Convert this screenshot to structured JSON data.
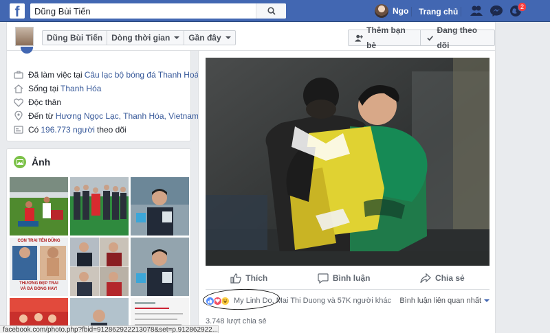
{
  "topbar": {
    "logo": "f",
    "search_value": "Dũng Bùi Tiến",
    "user_name": "Ngo",
    "home_label": "Trang chủ",
    "notification_count": "2",
    "brand_color": "#4267b2"
  },
  "profile_strip": {
    "breadcrumbs": [
      {
        "label": "Dũng Bùi Tiến"
      },
      {
        "label": "Dòng thời gian"
      },
      {
        "label": "Gần đây"
      }
    ],
    "add_friend_label": "Thêm bạn bè",
    "following_label": "Đang theo dõi"
  },
  "intro": {
    "work_prefix": "Đã làm việc tại",
    "work_link": "Câu lạc bộ bóng đá Thanh Hoá",
    "lives_prefix": "Sống tại",
    "lives_link": "Thanh Hóa",
    "relationship": "Độc thân",
    "from_prefix": "Đến từ",
    "from_link": "Hương Ngọc Lạc, Thanh Hóa, Vietnam",
    "followers_prefix": "Có",
    "followers_link": "196.773 người",
    "followers_suffix": "theo dõi"
  },
  "photos": {
    "title": "Ảnh",
    "thumb4_top": "CON TRAI TÊN DŨNG",
    "thumb4_bottom_1": "THƯƠNG ĐẸP TRAI",
    "thumb4_bottom_2": "VÀ ĐÁ BÓNG HAY!"
  },
  "post": {
    "like_label": "Thích",
    "comment_label": "Bình luận",
    "share_label": "Chia sẻ",
    "reactors": "My Linh Do, Mai Thi Duong và 57K người khác",
    "comment_sort": "Bình luận liên quan nhất",
    "shares": "3.748 lượt chia sẻ"
  },
  "status_bar": {
    "url": "facebook.com/photo.php?fbid=912862922213078&set=p.912862922..."
  }
}
